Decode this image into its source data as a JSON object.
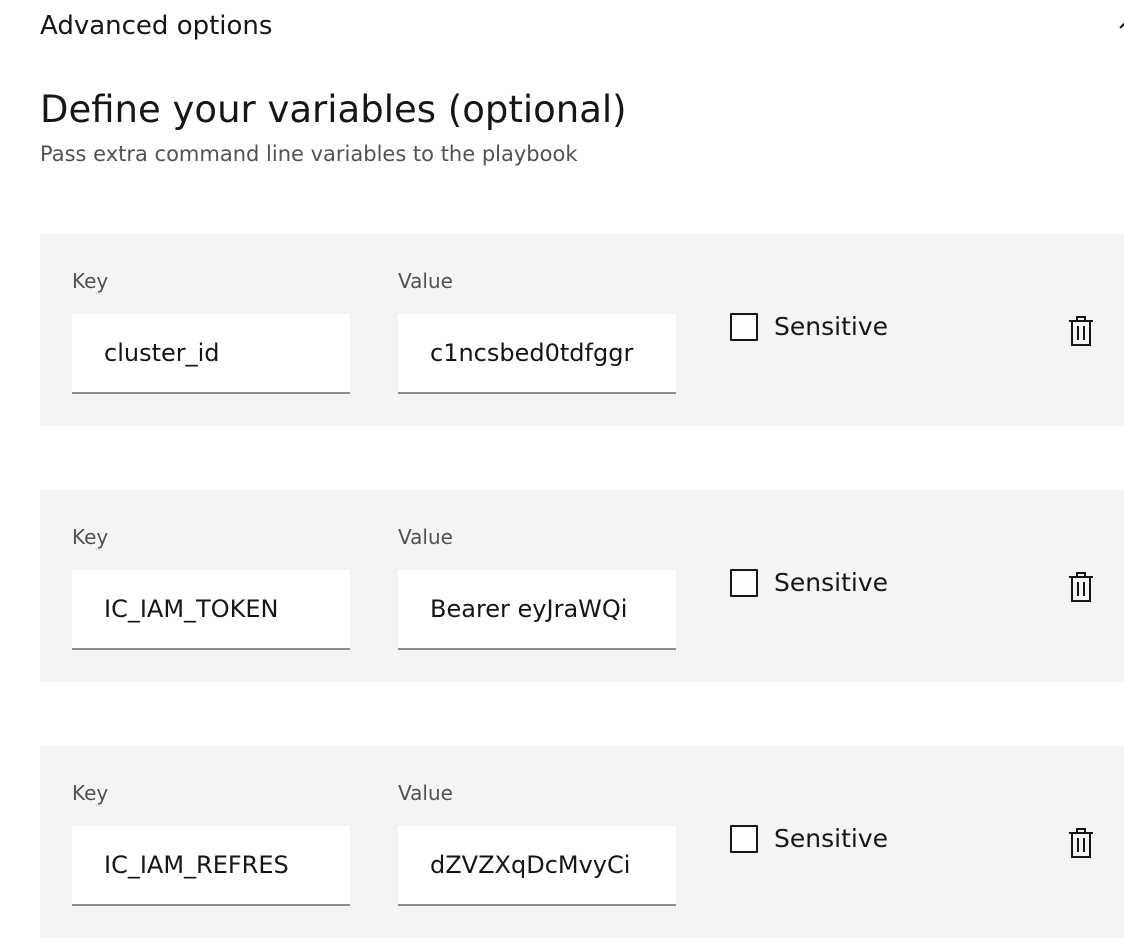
{
  "accordion": {
    "title": "Advanced options",
    "chevron_icon": "chevron-up-icon"
  },
  "section": {
    "title": "Define your variables (optional)",
    "subtitle": "Pass extra command line variables to the playbook"
  },
  "variables": [
    {
      "key_label": "Key",
      "value_label": "Value",
      "key": "cluster_id",
      "value": "c1ncsbed0tdfggr",
      "sensitive_label": "Sensitive",
      "sensitive_checked": false,
      "delete_icon": "trash-icon"
    },
    {
      "key_label": "Key",
      "value_label": "Value",
      "key": "IC_IAM_TOKEN",
      "value": "Bearer eyJraWQi",
      "sensitive_label": "Sensitive",
      "sensitive_checked": false,
      "delete_icon": "trash-icon"
    },
    {
      "key_label": "Key",
      "value_label": "Value",
      "key": "IC_IAM_REFRES",
      "value": "dZVZXqDcMvyCi",
      "sensitive_label": "Sensitive",
      "sensitive_checked": false,
      "delete_icon": "trash-icon"
    }
  ]
}
